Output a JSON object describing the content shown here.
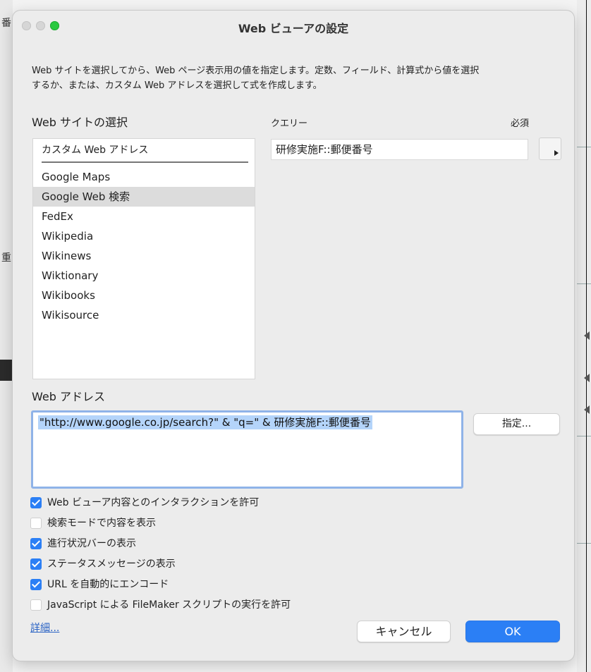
{
  "background": {
    "glyph1": "番",
    "glyph2": "重"
  },
  "dialog": {
    "title": "Web ビューアの設定",
    "description_line1": "Web サイトを選択してから、Web ページ表示用の値を指定します。定数、フィールド、計算式から値を選択",
    "description_line2": "するか、または、カスタム Web アドレスを選択して式を作成します。"
  },
  "sites": {
    "label": "Web サイトの選択",
    "custom": "カスタム Web アドレス",
    "items": [
      {
        "label": "Google Maps"
      },
      {
        "label": "Google Web 検索",
        "selected": true
      },
      {
        "label": "FedEx"
      },
      {
        "label": "Wikipedia"
      },
      {
        "label": "Wikinews"
      },
      {
        "label": "Wiktionary"
      },
      {
        "label": "Wikibooks"
      },
      {
        "label": "Wikisource"
      }
    ]
  },
  "query": {
    "header": "クエリー",
    "required_header": "必須",
    "value": "研修実施F::郵便番号"
  },
  "web_address": {
    "label": "Web アドレス",
    "value": "\"http://www.google.co.jp/search?\" & \"q=\" & 研修実施F::郵便番号",
    "specify_button": "指定..."
  },
  "options": [
    {
      "label": "Web ビューア内容とのインタラクションを許可",
      "checked": true
    },
    {
      "label": "検索モードで内容を表示",
      "checked": false
    },
    {
      "label": "進行状況バーの表示",
      "checked": true
    },
    {
      "label": "ステータスメッセージの表示",
      "checked": true
    },
    {
      "label": "URL を自動的にエンコード",
      "checked": true
    },
    {
      "label": "JavaScript による FileMaker スクリプトの実行を許可",
      "checked": false
    }
  ],
  "footer": {
    "details_link": "詳細...",
    "cancel_button": "キャンセル",
    "ok_button": "OK"
  },
  "colors": {
    "accent": "#2b7ff5",
    "selection": "#dcdcdc",
    "text_highlight": "#b4d4fa"
  }
}
